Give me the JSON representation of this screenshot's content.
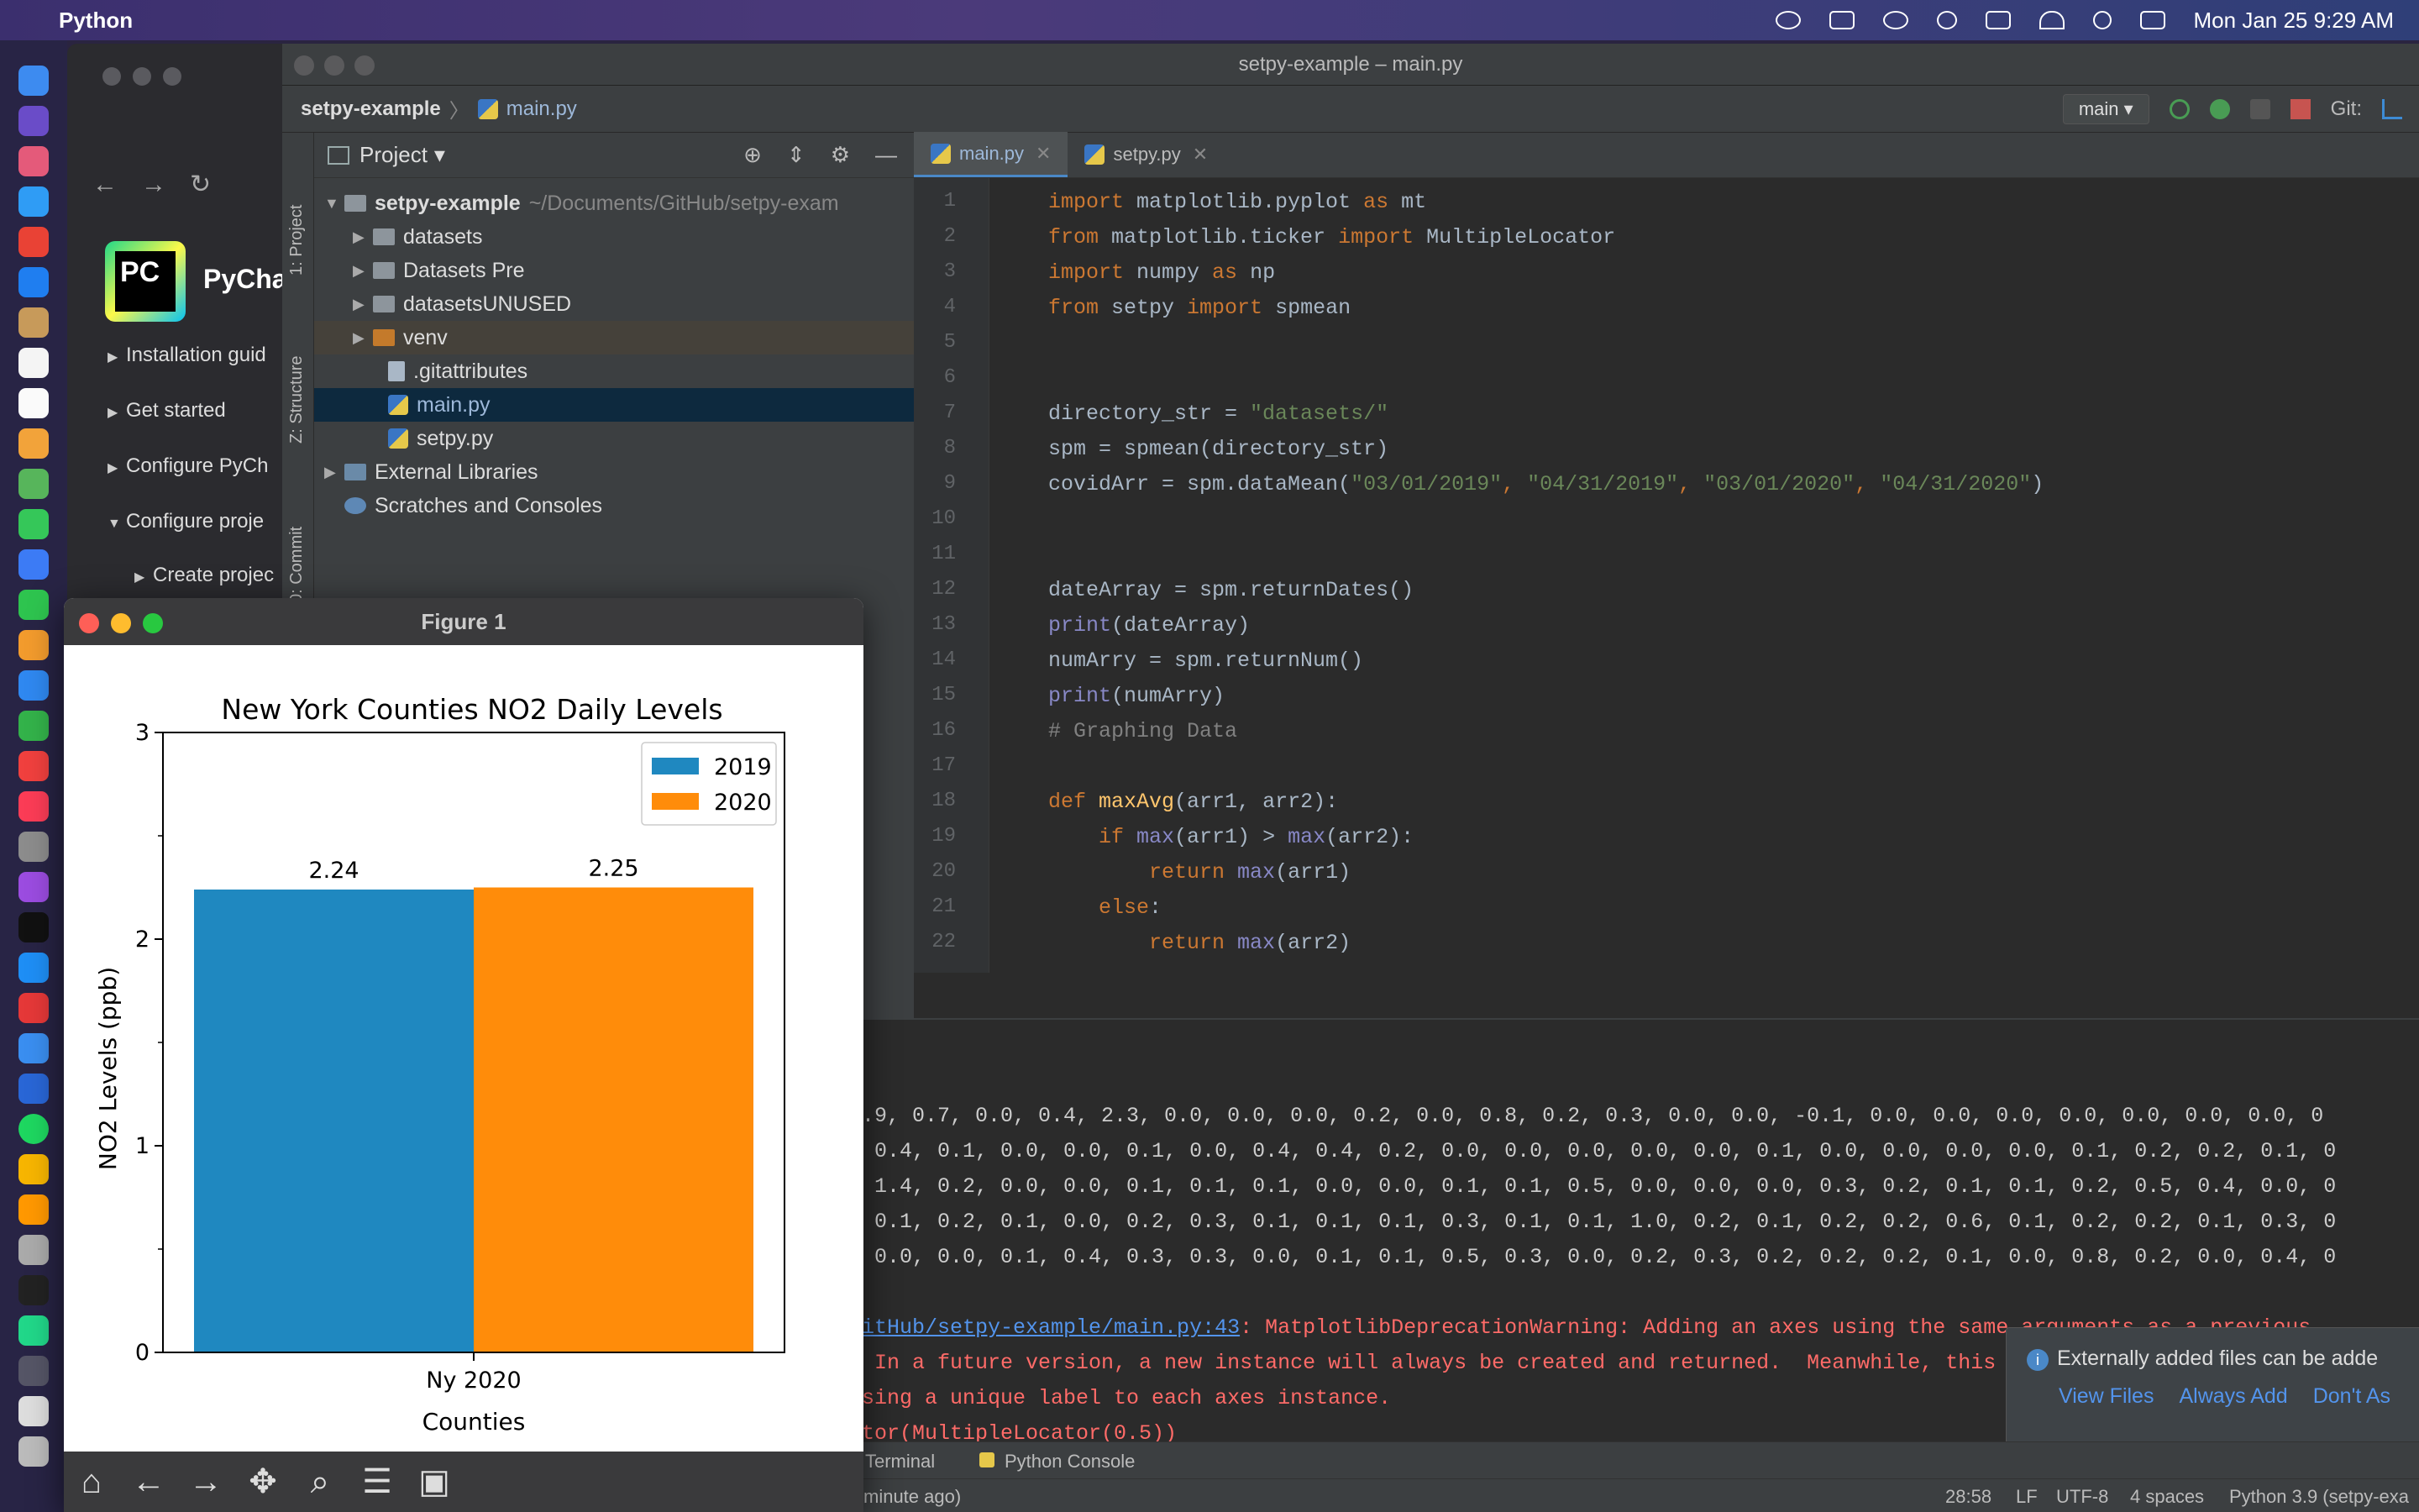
{
  "menubar": {
    "apple": "",
    "app": "Python",
    "datetime": "Mon Jan 25  9:29 AM"
  },
  "browser": {
    "pc_logo": "PC",
    "pc_name": "PyCha",
    "items": [
      "Installation guid",
      "Get started",
      "Configure PyCh",
      "Configure proje",
      "Create projec"
    ]
  },
  "ide": {
    "title": "setpy-example – main.py",
    "breadcrumb_project": "setpy-example",
    "breadcrumb_file": "main.py",
    "branch": "main",
    "git_label": "Git:",
    "project_label": "Project",
    "side_tabs": [
      "1: Project",
      "Z: Structure",
      "0: Commit"
    ],
    "tree": [
      {
        "label": "setpy-example",
        "note": "~/Documents/GitHub/setpy-exam"
      },
      {
        "label": "datasets"
      },
      {
        "label": "Datasets Pre"
      },
      {
        "label": "datasetsUNUSED"
      },
      {
        "label": "venv"
      },
      {
        "label": ".gitattributes"
      },
      {
        "label": "main.py"
      },
      {
        "label": "setpy.py"
      },
      {
        "label": "External Libraries"
      },
      {
        "label": "Scratches and Consoles"
      }
    ],
    "tabs": [
      {
        "label": "main.py"
      },
      {
        "label": "setpy.py"
      }
    ],
    "line_numbers": [
      "1",
      "2",
      "3",
      "4",
      "5",
      "6",
      "7",
      "8",
      "9",
      "10",
      "11",
      "12",
      "13",
      "14",
      "15",
      "16",
      "17",
      "18",
      "19",
      "20",
      "21",
      "22"
    ],
    "code": {
      "l1a": "import",
      "l1b": " matplotlib.pyplot ",
      "l1c": "as",
      "l1d": " mt",
      "l2a": "from",
      "l2b": " matplotlib.ticker ",
      "l2c": "import",
      "l2d": " MultipleLocator",
      "l3a": "import",
      "l3b": " numpy ",
      "l3c": "as",
      "l3d": " np",
      "l4a": "from",
      "l4b": " setpy ",
      "l4c": "import",
      "l4d": " spmean",
      "l7a": "directory_str = ",
      "l7b": "\"datasets/\"",
      "l8": "spm = spmean(directory_str)",
      "l9a": "covidArr = spm.dataMean(",
      "l9b": "\"03/01/2019\"",
      "l9c": ", ",
      "l9d": "\"04/31/2019\"",
      "l9e": ", ",
      "l9f": "\"03/01/2020\"",
      "l9g": ", ",
      "l9h": "\"04/31/2020\"",
      "l9i": ")",
      "l12": "dateArray = spm.returnDates()",
      "l13a": "print",
      "l13b": "(dateArray)",
      "l14": "numArry = spm.returnNum()",
      "l15a": "print",
      "l15b": "(numArry)",
      "l16": "# Graphing Data",
      "l18a": "def",
      "l18b": " maxAvg",
      "l18c": "(arr1, arr2):",
      "l19a": "    if ",
      "l19b": "max",
      "l19c": "(arr1) > ",
      "l19d": "max",
      "l19e": "(arr2):",
      "l20a": "        return ",
      "l20b": "max",
      "l20c": "(arr1)",
      "l21a": "    else",
      "l21b": ":",
      "l22a": "        return ",
      "l22b": "max",
      "l22c": "(arr2)"
    },
    "console_lines": [
      ".9, 0.7, 0.0, 0.4, 2.3, 0.0, 0.0, 0.0, 0.2, 0.0, 0.8, 0.2, 0.3, 0.0, 0.0, -0.1, 0.0, 0.0, 0.0, 0.0, 0.0, 0.0, 0.0, 0",
      " 0.4, 0.1, 0.0, 0.0, 0.1, 0.0, 0.4, 0.4, 0.2, 0.0, 0.0, 0.0, 0.0, 0.0, 0.1, 0.0, 0.0, 0.0, 0.0, 0.1, 0.2, 0.2, 0.1, 0",
      " 1.4, 0.2, 0.0, 0.0, 0.1, 0.1, 0.1, 0.0, 0.0, 0.1, 0.1, 0.5, 0.0, 0.0, 0.0, 0.3, 0.2, 0.1, 0.1, 0.2, 0.5, 0.4, 0.0, 0",
      " 0.1, 0.2, 0.1, 0.0, 0.2, 0.3, 0.1, 0.1, 0.1, 0.3, 0.1, 0.1, 1.0, 0.2, 0.1, 0.2, 0.2, 0.6, 0.1, 0.2, 0.2, 0.1, 0.3, 0",
      " 0.0, 0.0, 0.1, 0.4, 0.3, 0.3, 0.0, 0.1, 0.1, 0.5, 0.3, 0.0, 0.2, 0.3, 0.2, 0.2, 0.2, 0.1, 0.0, 0.8, 0.2, 0.0, 0.4, 0"
    ],
    "warning": {
      "link": "itHub/setpy-example/main.py:43",
      "msg1": ": MatplotlibDeprecationWarning: Adding an axes using the same arguments as a previous",
      "msg2": " In a future version, a new instance will always be created and returned.  Meanwhile, this warning can be suppressed",
      "msg3": "sing a unique label to each axes instance.",
      "msg4": "tor(MultipleLocator(0.5))"
    },
    "notification": {
      "text": "Externally added files can be adde",
      "view": "View Files",
      "always": "Always Add",
      "dont": "Don't As"
    },
    "bottom_tabs": {
      "terminal": "Terminal",
      "python_console": "Python Console"
    },
    "status": {
      "left": " minute ago)",
      "pos": "28:58",
      "lf": "LF",
      "enc": "UTF-8",
      "indent": "4 spaces",
      "interp": "Python 3.9 (setpy-exa"
    }
  },
  "figure": {
    "title": "Figure 1"
  },
  "chart_data": {
    "type": "bar",
    "title": "New York Counties NO2 Daily Levels",
    "xlabel": "Counties",
    "ylabel": "NO2 Levels (ppb)",
    "categories": [
      "Ny 2020"
    ],
    "series": [
      {
        "name": "2019",
        "values": [
          2.24
        ],
        "labels": [
          "2.24"
        ],
        "color": "#1f88c0"
      },
      {
        "name": "2020",
        "values": [
          2.25
        ],
        "labels": [
          "2.25"
        ],
        "color": "#ff8c0a"
      }
    ],
    "ylim": [
      0,
      3
    ],
    "yticks": [
      "0",
      "1",
      "2",
      "3"
    ],
    "legend": "top-right"
  }
}
